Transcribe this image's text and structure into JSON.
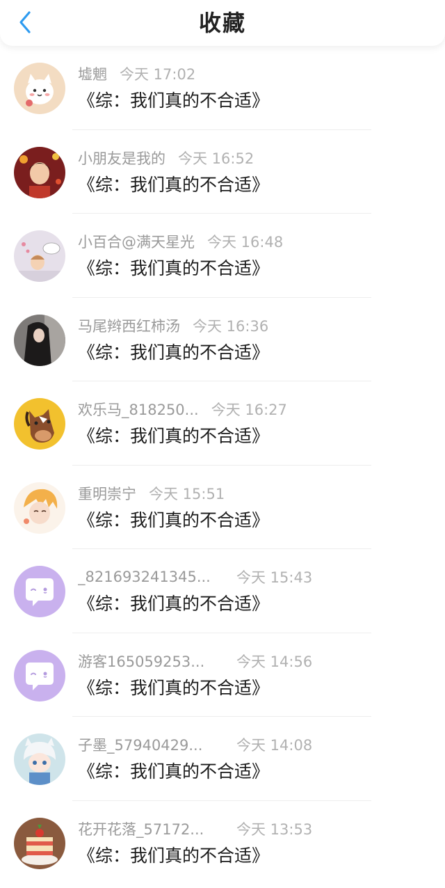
{
  "header": {
    "title": "收藏",
    "back_icon": "chevron-left-icon"
  },
  "colors": {
    "accent": "#2e9bf0",
    "meta_gray": "#9a9a9a",
    "divider": "#ededed",
    "default_avatar": "#c9b1ee"
  },
  "items": [
    {
      "name": "墟魍",
      "time": "今天 17:02",
      "title": "《综：我们真的不合适》",
      "avatar": "cat-avatar"
    },
    {
      "name": "小朋友是我的",
      "time": "今天 16:52",
      "title": "《综：我们真的不合适》",
      "avatar": "person-avatar"
    },
    {
      "name": "小百合@满天星光",
      "time": "今天 16:48",
      "title": "《综：我们真的不合适》",
      "avatar": "baby-avatar"
    },
    {
      "name": "马尾辫西红柿汤",
      "time": "今天 16:36",
      "title": "《综：我们真的不合适》",
      "avatar": "girl-avatar"
    },
    {
      "name": "欢乐马_818250...",
      "time": "今天 16:27",
      "title": "《综：我们真的不合适》",
      "avatar": "horse-avatar"
    },
    {
      "name": "重明崇宁",
      "time": "今天 15:51",
      "title": "《综：我们真的不合适》",
      "avatar": "anime-avatar"
    },
    {
      "name": "_821693241345...",
      "time": "今天 15:43",
      "title": "《综：我们真的不合适》",
      "avatar": "default-chat-avatar"
    },
    {
      "name": "游客165059253...",
      "time": "今天 14:56",
      "title": "《综：我们真的不合适》",
      "avatar": "default-chat-avatar"
    },
    {
      "name": "子墨_57940429...",
      "time": "今天 14:08",
      "title": "《综：我们真的不合适》",
      "avatar": "chibi-avatar"
    },
    {
      "name": "花开花落_57172...",
      "time": "今天 13:53",
      "title": "《综：我们真的不合适》",
      "avatar": "cake-avatar"
    }
  ]
}
